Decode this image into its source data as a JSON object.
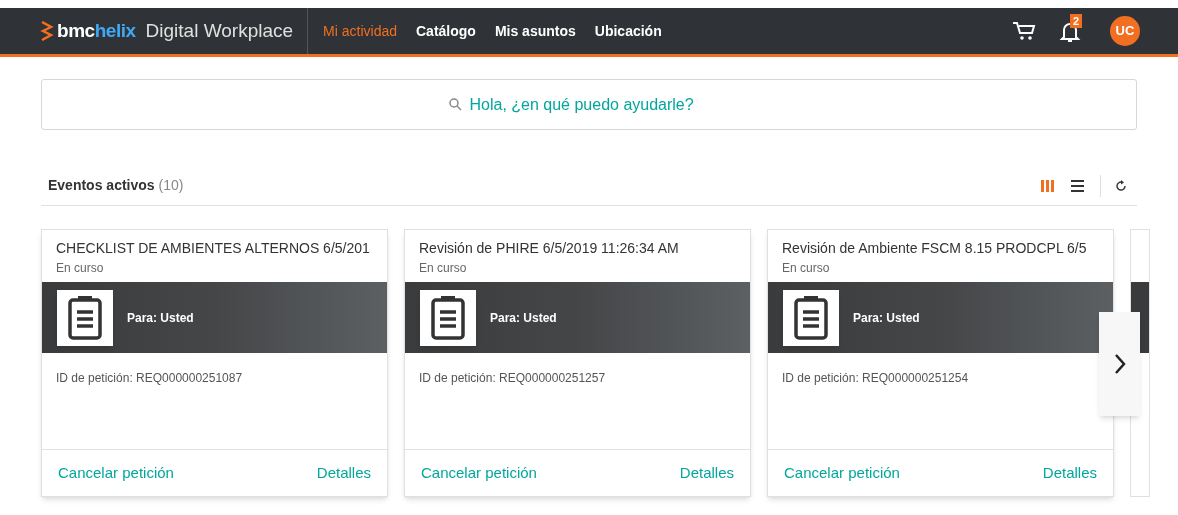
{
  "brand": {
    "logo_part1": "bmc",
    "logo_part2": "helix",
    "product": "Digital Workplace"
  },
  "nav": [
    {
      "label": "Mi actividad",
      "selected": true
    },
    {
      "label": "Catálogo",
      "selected": false
    },
    {
      "label": "Mis asuntos",
      "selected": false
    },
    {
      "label": "Ubicación",
      "selected": false
    }
  ],
  "notifications": {
    "badge": "2"
  },
  "user": {
    "initials": "UC"
  },
  "search": {
    "placeholder": "Hola, ¿en qué puedo ayudarle?"
  },
  "section": {
    "title": "Eventos activos",
    "count": "(10)"
  },
  "views": [
    {
      "kind": "columns",
      "selected": true
    },
    {
      "kind": "list",
      "selected": false
    }
  ],
  "cards": [
    {
      "title": "CHECKLIST DE AMBIENTES ALTERNOS 6/5/201",
      "status": "En curso",
      "for": "Para: Usted",
      "request_id": "ID de petición: REQ000000251087",
      "cancel": "Cancelar petición",
      "details": "Detalles"
    },
    {
      "title": "Revisión de PHIRE 6/5/2019 11:26:34 AM",
      "status": "En curso",
      "for": "Para: Usted",
      "request_id": "ID de petición: REQ000000251257",
      "cancel": "Cancelar petición",
      "details": "Detalles"
    },
    {
      "title": "Revisión de Ambiente FSCM 8.15 PRODCPL 6/5",
      "status": "En curso",
      "for": "Para: Usted",
      "request_id": "ID de petición: REQ000000251254",
      "cancel": "Cancelar petición",
      "details": "Detalles"
    }
  ]
}
